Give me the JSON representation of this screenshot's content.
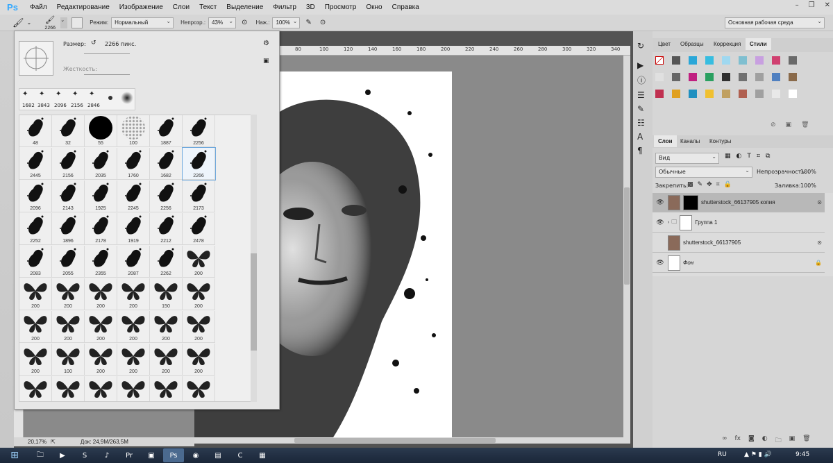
{
  "menu": {
    "logo": "Ps",
    "items": [
      "Файл",
      "Редактирование",
      "Изображение",
      "Слои",
      "Текст",
      "Выделение",
      "Фильтр",
      "3D",
      "Просмотр",
      "Окно",
      "Справка"
    ]
  },
  "options": {
    "brush_size": "2266",
    "mode_label": "Режим:",
    "mode_value": "Нормальный",
    "opacity_label": "Непрозр.:",
    "opacity_value": "43%",
    "flow_label": "Наж.:",
    "flow_value": "100%",
    "workspace": "Основная рабочая среда"
  },
  "brush_panel": {
    "size_label": "Размер:",
    "size_value": "2266 пикс.",
    "hardness_label": "Жесткость:",
    "recent": [
      "1682",
      "3843",
      "2096",
      "2156",
      "2846",
      "",
      ""
    ],
    "tips": [
      [
        "48",
        "32",
        "55",
        "100",
        "1887",
        "2256"
      ],
      [
        "2445",
        "2156",
        "2035",
        "1760",
        "1682",
        "2266"
      ],
      [
        "2096",
        "2143",
        "1925",
        "2245",
        "2256",
        "2173"
      ],
      [
        "2252",
        "1896",
        "2178",
        "1919",
        "2212",
        "2478"
      ],
      [
        "2083",
        "2055",
        "2355",
        "2087",
        "2262",
        "200"
      ],
      [
        "200",
        "200",
        "200",
        "200",
        "150",
        "200"
      ],
      [
        "200",
        "200",
        "200",
        "200",
        "200",
        "200"
      ],
      [
        "200",
        "100",
        "200",
        "200",
        "200",
        "200"
      ],
      [
        "100",
        "100",
        "100",
        "100",
        "100",
        "100"
      ]
    ]
  },
  "ruler": [
    "80",
    "100",
    "120",
    "140",
    "160",
    "180",
    "200",
    "220",
    "240",
    "260",
    "280",
    "300",
    "320",
    "340"
  ],
  "status": {
    "zoom": "20,17%",
    "doc": "Док: 24,9M/263,5M"
  },
  "panels": {
    "top_tabs": [
      "Цвет",
      "Образцы",
      "Коррекция",
      "Стили"
    ],
    "active_top_tab": "Стили",
    "layer_tabs": [
      "Слои",
      "Каналы",
      "Контуры"
    ],
    "filter_label": "Вид",
    "blend": "Обычные",
    "opacity_label": "Непрозрачность:",
    "opacity_value": "100%",
    "lock_label": "Закрепить:",
    "fill_label": "Заливка:",
    "fill_value": "100%",
    "layers": [
      {
        "name": "shutterstock_66137905 копия",
        "visible": true
      },
      {
        "name": "Группа 1",
        "visible": true
      },
      {
        "name": "shutterstock_66137905",
        "visible": false
      },
      {
        "name": "Фон",
        "visible": true
      }
    ]
  },
  "taskbar": {
    "lang": "RU",
    "time": "9:45"
  },
  "colors": {
    "ps_blue": "#31a8ff",
    "panel_bg": "#d6d6d6",
    "canvas_bg": "#8a8a8a"
  }
}
